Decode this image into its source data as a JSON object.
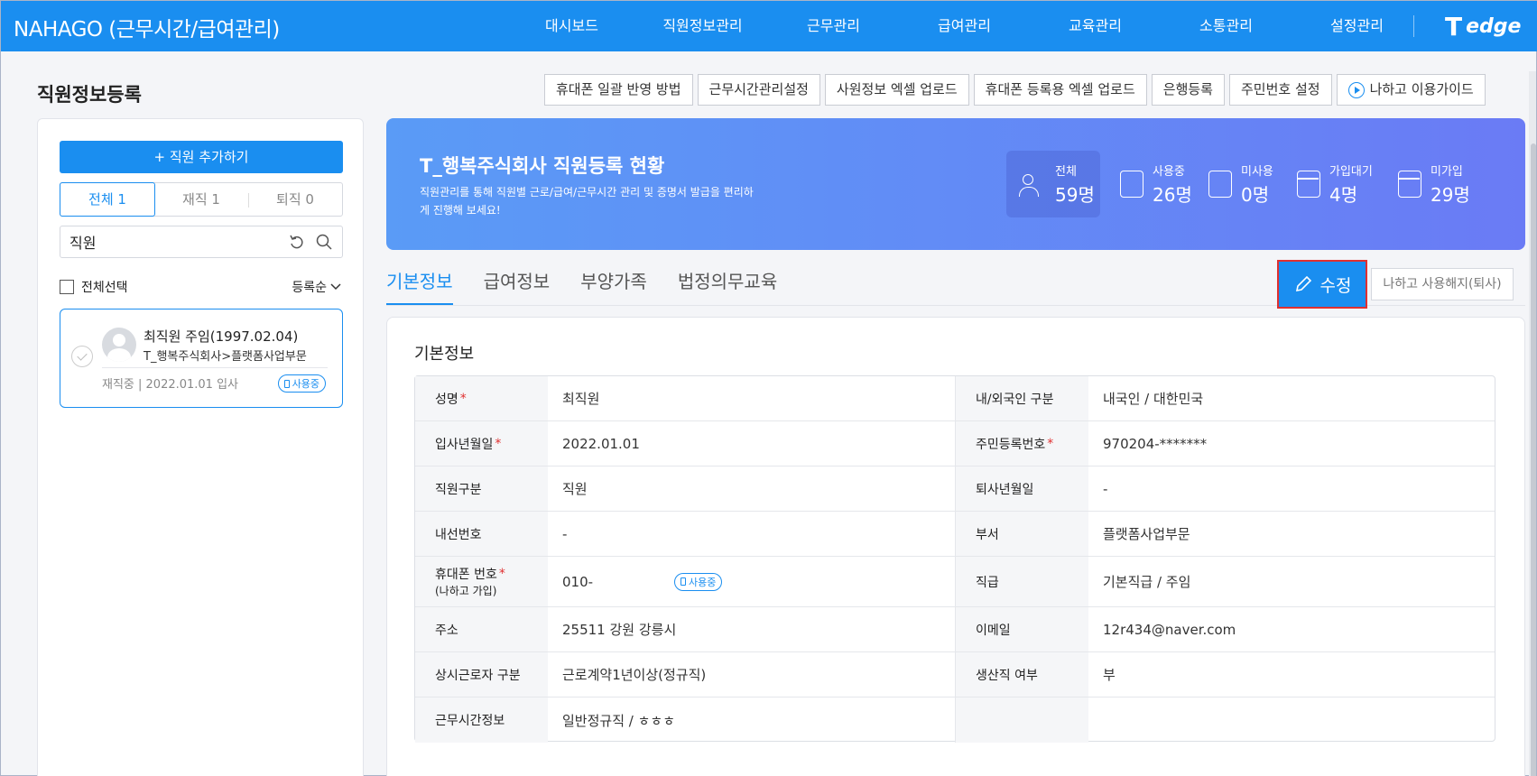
{
  "app": {
    "title": "NAHAGO (근무시간/급여관리)",
    "logo": "edge"
  },
  "nav": [
    "대시보드",
    "직원정보관리",
    "근무관리",
    "급여관리",
    "교육관리",
    "소통관리",
    "설정관리"
  ],
  "page_title": "직원정보등록",
  "actions": [
    "휴대폰 일괄 반영 방법",
    "근무시간관리설정",
    "사원정보 엑셀 업로드",
    "휴대폰 등록용 엑셀 업로드",
    "은행등록",
    "주민번호 설정",
    "나하고 이용가이드"
  ],
  "sidebar": {
    "add_button": "+ 직원 추가하기",
    "filter_tabs": [
      "전체 1",
      "재직 1",
      "퇴직 0"
    ],
    "search_value": "직원",
    "select_all": "전체선택",
    "sort": "등록순",
    "employee": {
      "name": "최직원 주임(1997.02.04)",
      "dept": "T_행복주식회사>플랫폼사업부문",
      "status": "재직중 | 2022.01.01 입사",
      "badge": "사용중"
    }
  },
  "banner": {
    "title": "T_행복주식회사 직원등록 현황",
    "desc": "직원관리를 통해 직원별 근로/급여/근무시간 관리 및 증명서 발급을 편리하게 진행해 보세요!",
    "stats": [
      {
        "label": "전체",
        "value": "59명",
        "icon": "users-icon"
      },
      {
        "label": "사용중",
        "value": "26명",
        "icon": "phone-check-icon"
      },
      {
        "label": "미사용",
        "value": "0명",
        "icon": "phone-x-icon"
      },
      {
        "label": "가입대기",
        "value": "4명",
        "icon": "calendar-icon"
      },
      {
        "label": "미가입",
        "value": "29명",
        "icon": "calendar-x-icon"
      }
    ]
  },
  "tabs": [
    "기본정보",
    "급여정보",
    "부양가족",
    "법정의무교육"
  ],
  "edit_button": "수정",
  "quit_button": "나하고 사용해지(퇴사)",
  "info": {
    "title": "기본정보",
    "rows": [
      {
        "l_label": "성명",
        "l_req": "*",
        "l_value": "최직원",
        "r_label": "내/외국인 구분",
        "r_req": "",
        "r_value": "내국인 / 대한민국"
      },
      {
        "l_label": "입사년월일",
        "l_req": "*",
        "l_value": "2022.01.01",
        "r_label": "주민등록번호",
        "r_req": "*",
        "r_value": "970204-*******"
      },
      {
        "l_label": "직원구분",
        "l_req": "",
        "l_value": "직원",
        "r_label": "퇴사년월일",
        "r_req": "",
        "r_value": "-"
      },
      {
        "l_label": "내선번호",
        "l_req": "",
        "l_value": "-",
        "r_label": "부서",
        "r_req": "",
        "r_value": "플랫폼사업부문"
      },
      {
        "l_label": "휴대폰 번호",
        "l_req": "*",
        "l_sub": "(나하고 가입)",
        "l_value": "010-",
        "l_badge": "사용중",
        "r_label": "직급",
        "r_req": "",
        "r_value": "기본직급 / 주임"
      },
      {
        "l_label": "주소",
        "l_req": "",
        "l_value": "25511 강원 강릉시",
        "r_label": "이메일",
        "r_req": "",
        "r_value": "12r434@naver.com"
      },
      {
        "l_label": "상시근로자 구분",
        "l_req": "",
        "l_value": "근로계약1년이상(정규직)",
        "r_label": "생산직 여부",
        "r_req": "",
        "r_value": "부"
      },
      {
        "l_label": "근무시간정보",
        "l_req": "",
        "l_value": "일반정규직 / ㅎㅎㅎ",
        "r_label": "",
        "r_req": "",
        "r_value": ""
      }
    ]
  }
}
